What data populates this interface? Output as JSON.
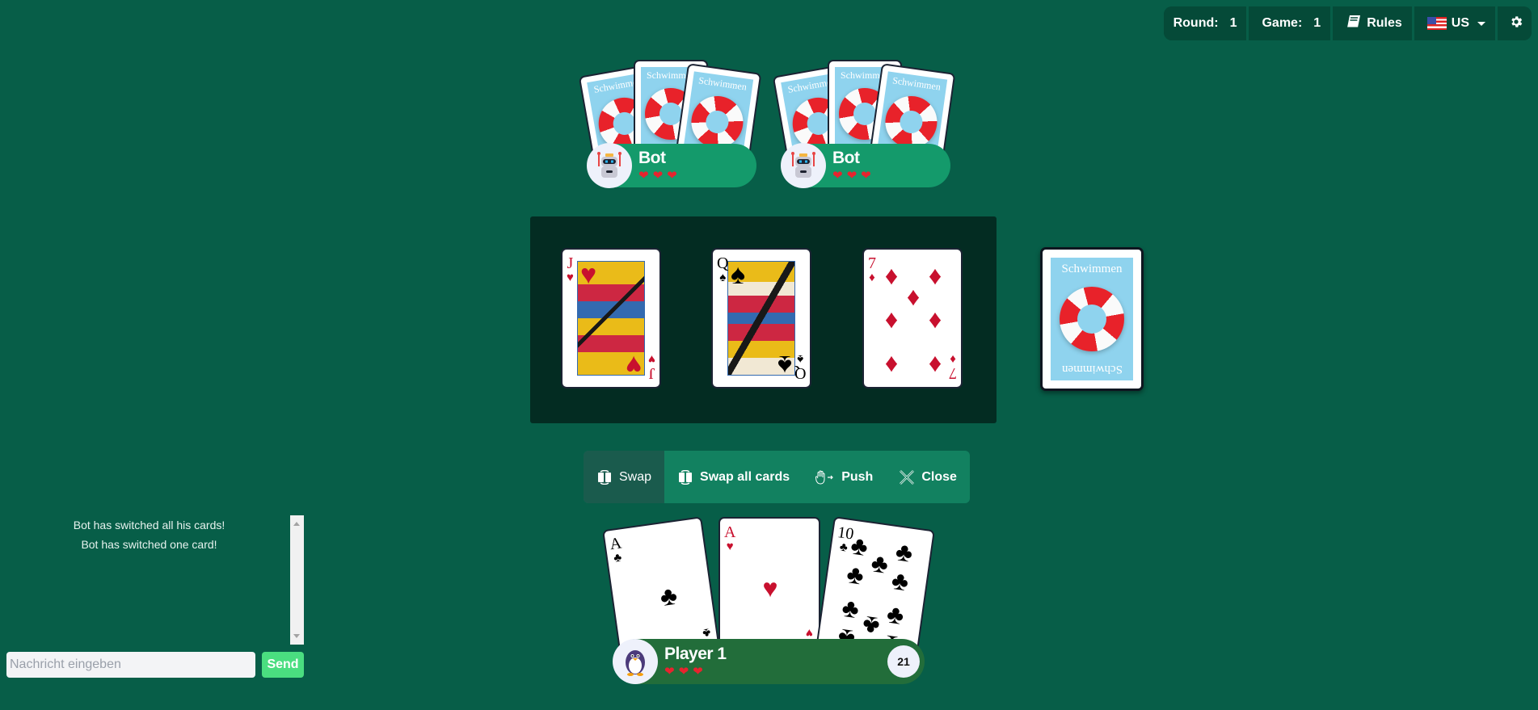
{
  "topbar": {
    "round_label": "Round:",
    "round_value": "1",
    "game_label": "Game:",
    "game_value": "1",
    "rules_label": "Rules",
    "language": "US",
    "icons": [
      "book-icon",
      "us-flag-icon",
      "chevron-down-icon",
      "gear-icon"
    ]
  },
  "opponents": [
    {
      "name": "Bot",
      "lives": 3,
      "card_count": 3,
      "avatar": "robot-icon"
    },
    {
      "name": "Bot",
      "lives": 3,
      "card_count": 3,
      "avatar": "robot-icon"
    }
  ],
  "card_back": {
    "label": "Schwimmen"
  },
  "table_cards": [
    {
      "rank": "J",
      "suit": "♥",
      "suit_name": "hearts",
      "color": "red"
    },
    {
      "rank": "Q",
      "suit": "♠",
      "suit_name": "spades",
      "color": "black"
    },
    {
      "rank": "7",
      "suit": "♦",
      "suit_name": "diamonds",
      "color": "red"
    }
  ],
  "actions": [
    {
      "label": "Swap",
      "icon": "swap-icon",
      "active": true
    },
    {
      "label": "Swap all cards",
      "icon": "swap-all-icon",
      "active": false
    },
    {
      "label": "Push",
      "icon": "hand-push-icon",
      "active": false
    },
    {
      "label": "Close",
      "icon": "close-icon",
      "active": false
    }
  ],
  "player": {
    "name": "Player 1",
    "lives": 3,
    "score": "21",
    "avatar": "penguin-icon",
    "hand": [
      {
        "rank": "A",
        "suit": "♣",
        "suit_name": "clubs",
        "color": "black"
      },
      {
        "rank": "A",
        "suit": "♥",
        "suit_name": "hearts",
        "color": "red"
      },
      {
        "rank": "10",
        "suit": "♣",
        "suit_name": "clubs",
        "color": "black"
      }
    ]
  },
  "chat": {
    "messages": [
      "Bot has switched all his cards!",
      "Bot has switched one card!"
    ],
    "input_placeholder": "Nachricht eingeben",
    "input_value": "",
    "send_label": "Send"
  },
  "colors": {
    "background": "#075e48",
    "table": "#032c22",
    "bot_plate": "#149a6b",
    "player_plate": "#226d3a",
    "action_bar": "#128160",
    "send_button": "#4ade80",
    "card_red": "#c8102e"
  }
}
